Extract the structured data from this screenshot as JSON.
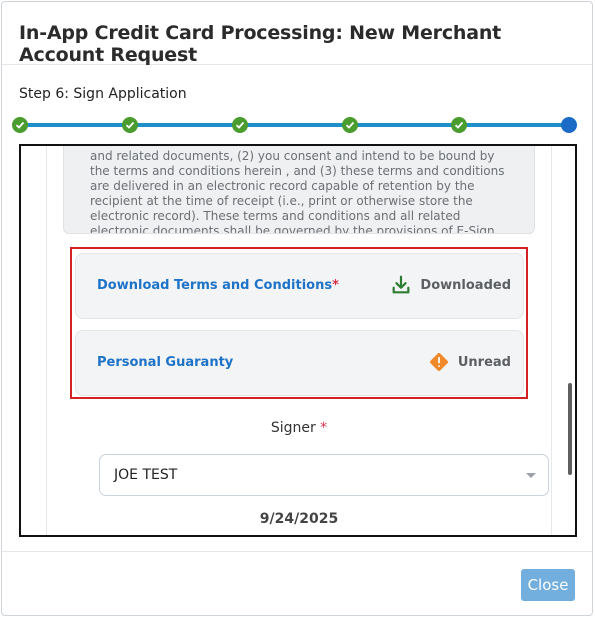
{
  "modal": {
    "title": "In-App Credit Card Processing: New Merchant Account Request"
  },
  "step": {
    "label": "Step 6: Sign Application",
    "total": 6,
    "current": 6
  },
  "terms": {
    "text_lines": [
      "and related documents, (2) you consent and intend to be bound by",
      "the terms and conditions herein , and (3) these terms and conditions",
      "are delivered in an electronic record capable of retention by the",
      "recipient at the time of receipt (i.e., print or otherwise store the",
      "electronic record). These terms and conditions and all related",
      "electronic documents shall be governed by the provisions of E-Sign"
    ]
  },
  "documents": [
    {
      "label": "Download Terms and Conditions",
      "required": "*",
      "status": "Downloaded",
      "icon": "download-icon"
    },
    {
      "label": "Personal Guaranty",
      "required": "",
      "status": "Unread",
      "icon": "warning-icon"
    }
  ],
  "signer": {
    "label": "Signer",
    "required": "*",
    "value": "JOE TEST"
  },
  "date": "9/24/2025",
  "footer": {
    "close_label": "Close"
  },
  "colors": {
    "step_complete": "#4a9c2e",
    "step_current": "#1c6bc6",
    "link": "#1e73c8",
    "download_icon": "#2e7d32",
    "warning_icon": "#f0892a",
    "highlight_border": "#d42222",
    "close_button": "#72aede"
  }
}
